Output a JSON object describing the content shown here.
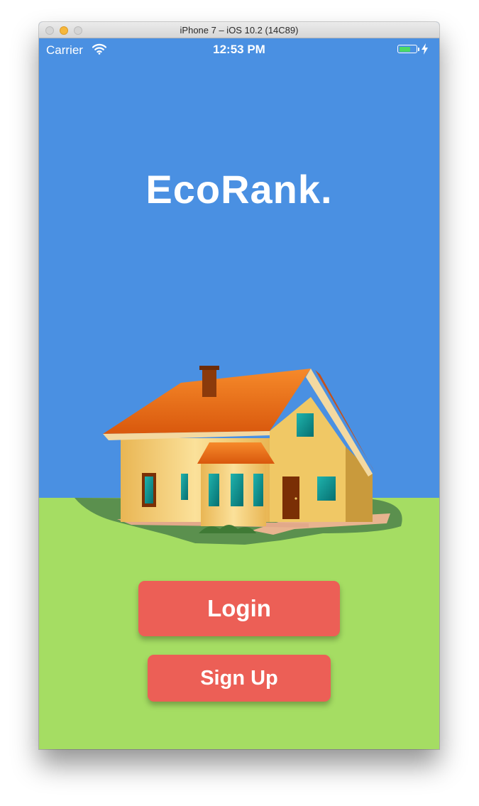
{
  "window": {
    "title": "iPhone 7 – iOS 10.2 (14C89)"
  },
  "status_bar": {
    "carrier": "Carrier",
    "time": "12:53 PM",
    "battery_level": 0.7
  },
  "app": {
    "title": "EcoRank."
  },
  "buttons": {
    "login_label": "Login",
    "signup_label": "Sign Up"
  },
  "colors": {
    "sky": "#4a90e2",
    "grass": "#a5dd63",
    "button": "#ec5f56",
    "roof": "#f0761e",
    "house_wall": "#f3cf73"
  },
  "icons": {
    "wifi": "wifi-icon",
    "battery": "battery-icon",
    "charging": "charging-bolt-icon",
    "illustration": "house-illustration"
  }
}
